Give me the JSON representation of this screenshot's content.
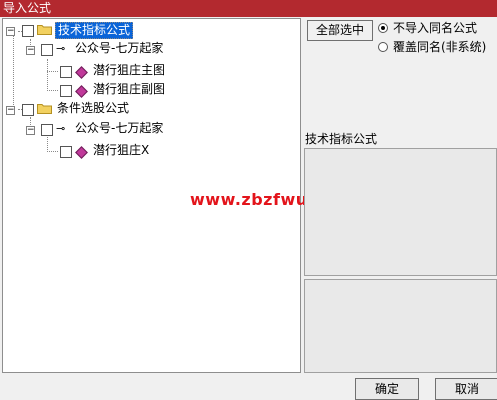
{
  "window": {
    "title": "导入公式"
  },
  "tree": {
    "nodes": [
      {
        "label": "技术指标公式",
        "expander": "−"
      },
      {
        "label": "公众号-七万起家",
        "expander": "−"
      },
      {
        "label": "潜行狙庄主图"
      },
      {
        "label": "潜行狙庄副图"
      },
      {
        "label": "条件选股公式",
        "expander": "−"
      },
      {
        "label": "公众号-七万起家",
        "expander": "−"
      },
      {
        "label": "潜行狙庄X"
      }
    ]
  },
  "watermark": "www.zbzfwu.com",
  "actions": {
    "select_all": "全部选中",
    "options": [
      {
        "label": "不导入同名公式",
        "selected": true
      },
      {
        "label": "覆盖同名(非系统)",
        "selected": false
      }
    ]
  },
  "info": {
    "title": "技术指标公式"
  },
  "footer": {
    "ok": "确定",
    "cancel": "取消"
  },
  "colors": {
    "titlebar": "#b3292f",
    "selection": "#0a64d8",
    "watermark": "#e3141b",
    "formula_icon": "#c0399a"
  }
}
